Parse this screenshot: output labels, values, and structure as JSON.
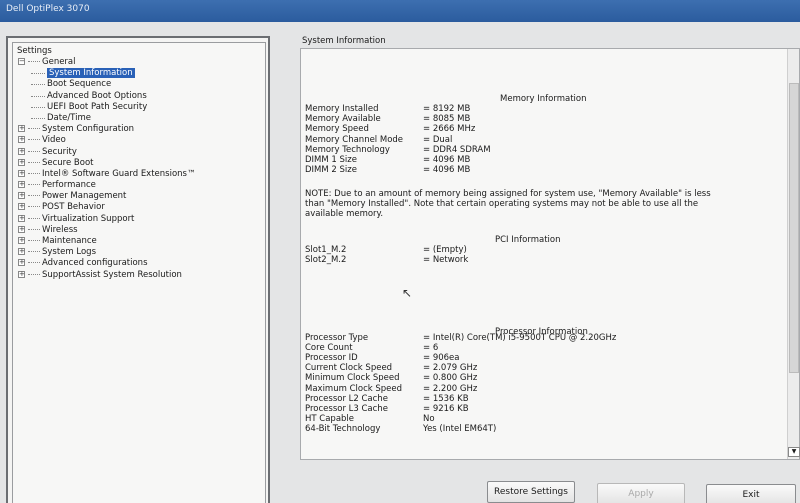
{
  "window": {
    "title": "Dell OptiPlex 3070"
  },
  "tree": {
    "root": "Settings",
    "items": [
      {
        "label": "General",
        "expander": "−",
        "level": 1
      },
      {
        "label": "System Information",
        "level": 2,
        "selected": true
      },
      {
        "label": "Boot Sequence",
        "level": 2
      },
      {
        "label": "Advanced Boot Options",
        "level": 2
      },
      {
        "label": "UEFI Boot Path Security",
        "level": 2
      },
      {
        "label": "Date/Time",
        "level": 2
      },
      {
        "label": "System Configuration",
        "expander": "+",
        "level": 1
      },
      {
        "label": "Video",
        "expander": "+",
        "level": 1
      },
      {
        "label": "Security",
        "expander": "+",
        "level": 1
      },
      {
        "label": "Secure Boot",
        "expander": "+",
        "level": 1
      },
      {
        "label": "Intel® Software Guard Extensions™",
        "expander": "+",
        "level": 1
      },
      {
        "label": "Performance",
        "expander": "+",
        "level": 1
      },
      {
        "label": "Power Management",
        "expander": "+",
        "level": 1
      },
      {
        "label": "POST Behavior",
        "expander": "+",
        "level": 1
      },
      {
        "label": "Virtualization Support",
        "expander": "+",
        "level": 1
      },
      {
        "label": "Wireless",
        "expander": "+",
        "level": 1
      },
      {
        "label": "Maintenance",
        "expander": "+",
        "level": 1
      },
      {
        "label": "System Logs",
        "expander": "+",
        "level": 1
      },
      {
        "label": "Advanced configurations",
        "expander": "+",
        "level": 1
      },
      {
        "label": "SupportAssist System Resolution",
        "expander": "+",
        "level": 1
      }
    ]
  },
  "main": {
    "section_title": "System Information",
    "memory": {
      "heading": "Memory Information",
      "rows": [
        {
          "k": "Memory Installed",
          "v": "= 8192 MB"
        },
        {
          "k": "Memory Available",
          "v": "= 8085 MB"
        },
        {
          "k": "Memory Speed",
          "v": "= 2666 MHz"
        },
        {
          "k": "Memory Channel Mode",
          "v": "= Dual"
        },
        {
          "k": "Memory Technology",
          "v": "= DDR4 SDRAM"
        },
        {
          "k": "DIMM 1 Size",
          "v": "= 4096 MB"
        },
        {
          "k": "DIMM 2 Size",
          "v": "= 4096 MB"
        }
      ],
      "note": "NOTE: Due to an amount of memory being assigned for system use, \"Memory Available\" is less than \"Memory Installed\". Note that certain operating systems may not be able to use all the available memory."
    },
    "pci": {
      "heading": "PCI Information",
      "rows": [
        {
          "k": "Slot1_M.2",
          "v": "= (Empty)"
        },
        {
          "k": "Slot2_M.2",
          "v": "= Network"
        }
      ]
    },
    "processor": {
      "heading": "Processor Information",
      "rows": [
        {
          "k": "Processor Type",
          "v": "= Intel(R) Core(TM) i5-9500T CPU @ 2.20GHz"
        },
        {
          "k": "Core Count",
          "v": "= 6"
        },
        {
          "k": "Processor ID",
          "v": "= 906ea"
        },
        {
          "k": "Current Clock Speed",
          "v": "= 2.079 GHz"
        },
        {
          "k": "Minimum Clock Speed",
          "v": "= 0.800 GHz"
        },
        {
          "k": "Maximum Clock Speed",
          "v": "= 2.200 GHz"
        },
        {
          "k": "Processor L2 Cache",
          "v": "= 1536 KB"
        },
        {
          "k": "Processor L3 Cache",
          "v": "= 9216 KB"
        },
        {
          "k": "HT Capable",
          "v": "No"
        },
        {
          "k": "64-Bit Technology",
          "v": "Yes (Intel EM64T)"
        }
      ]
    }
  },
  "buttons": {
    "restore": "Restore Settings",
    "apply": "Apply",
    "exit": "Exit"
  }
}
